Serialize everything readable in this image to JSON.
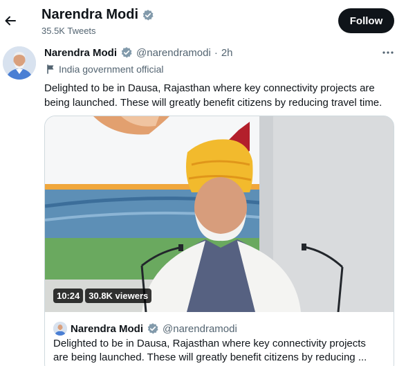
{
  "header": {
    "title": "Narendra Modi",
    "tweet_count": "35.5K Tweets",
    "follow_label": "Follow"
  },
  "tweet": {
    "author_name": "Narendra Modi",
    "handle": "@narendramodi",
    "separator": "·",
    "time": "2h",
    "label": "India government official",
    "text": "Delighted to be in Dausa, Rajasthan where key connectivity projects are being launched. These will greatly benefit citizens by reducing travel time."
  },
  "video": {
    "duration": "10:24",
    "views": "30.8K viewers"
  },
  "quote": {
    "author_name": "Narendra Modi",
    "handle": "@narendramodi",
    "text_line1": "Delighted to be in Dausa, Rajasthan where key connectivity projects",
    "text_line2": "are being launched. These will greatly benefit citizens by reducing ..."
  },
  "icons": {
    "back": "arrow-left-icon",
    "verified": "verified-badge-icon",
    "more": "more-horizontal-icon",
    "flag": "flag-icon"
  },
  "colors": {
    "verified_badge": "#829aab",
    "follow_button": "#0f1419",
    "secondary_text": "#536471"
  }
}
